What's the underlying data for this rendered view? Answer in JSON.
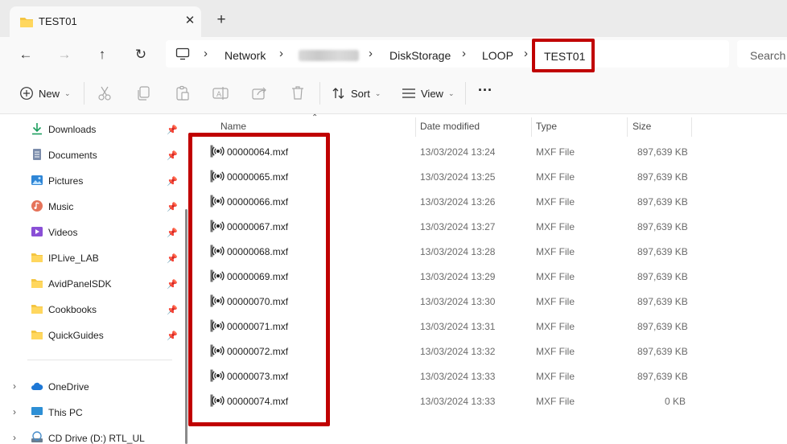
{
  "tab": {
    "title": "TEST01",
    "close_icon": "close-icon",
    "new_tab": "+"
  },
  "breadcrumb": {
    "items": [
      "Network",
      "DiskStorage",
      "LOOP"
    ],
    "current": "TEST01"
  },
  "search": {
    "placeholder": "Search T"
  },
  "toolbar": {
    "new_label": "New",
    "sort_label": "Sort",
    "view_label": "View",
    "more_label": "···"
  },
  "sidebar": {
    "items": [
      {
        "label": "Downloads",
        "icon": "download-icon"
      },
      {
        "label": "Documents",
        "icon": "document-icon"
      },
      {
        "label": "Pictures",
        "icon": "pictures-icon"
      },
      {
        "label": "Music",
        "icon": "music-icon"
      },
      {
        "label": "Videos",
        "icon": "videos-icon"
      },
      {
        "label": "IPLive_LAB",
        "icon": "folder-icon"
      },
      {
        "label": "AvidPanelSDK",
        "icon": "folder-icon"
      },
      {
        "label": "Cookbooks",
        "icon": "folder-icon"
      },
      {
        "label": "QuickGuides",
        "icon": "folder-icon"
      }
    ],
    "tree": [
      {
        "label": "OneDrive",
        "icon": "cloud-icon"
      },
      {
        "label": "This PC",
        "icon": "pc-icon"
      },
      {
        "label": "CD Drive (D:) RTL_UL",
        "icon": "cd-drive-icon"
      }
    ]
  },
  "columns": {
    "name": "Name",
    "date": "Date modified",
    "type": "Type",
    "size": "Size"
  },
  "files": [
    {
      "name": "00000064.mxf",
      "date": "13/03/2024 13:24",
      "type": "MXF File",
      "size": "897,639 KB"
    },
    {
      "name": "00000065.mxf",
      "date": "13/03/2024 13:25",
      "type": "MXF File",
      "size": "897,639 KB"
    },
    {
      "name": "00000066.mxf",
      "date": "13/03/2024 13:26",
      "type": "MXF File",
      "size": "897,639 KB"
    },
    {
      "name": "00000067.mxf",
      "date": "13/03/2024 13:27",
      "type": "MXF File",
      "size": "897,639 KB"
    },
    {
      "name": "00000068.mxf",
      "date": "13/03/2024 13:28",
      "type": "MXF File",
      "size": "897,639 KB"
    },
    {
      "name": "00000069.mxf",
      "date": "13/03/2024 13:29",
      "type": "MXF File",
      "size": "897,639 KB"
    },
    {
      "name": "00000070.mxf",
      "date": "13/03/2024 13:30",
      "type": "MXF File",
      "size": "897,639 KB"
    },
    {
      "name": "00000071.mxf",
      "date": "13/03/2024 13:31",
      "type": "MXF File",
      "size": "897,639 KB"
    },
    {
      "name": "00000072.mxf",
      "date": "13/03/2024 13:32",
      "type": "MXF File",
      "size": "897,639 KB"
    },
    {
      "name": "00000073.mxf",
      "date": "13/03/2024 13:33",
      "type": "MXF File",
      "size": "897,639 KB"
    },
    {
      "name": "00000074.mxf",
      "date": "13/03/2024 13:33",
      "type": "MXF File",
      "size": "0 KB"
    }
  ],
  "colors": {
    "highlight": "#c00000",
    "folder": "#f4c542"
  }
}
